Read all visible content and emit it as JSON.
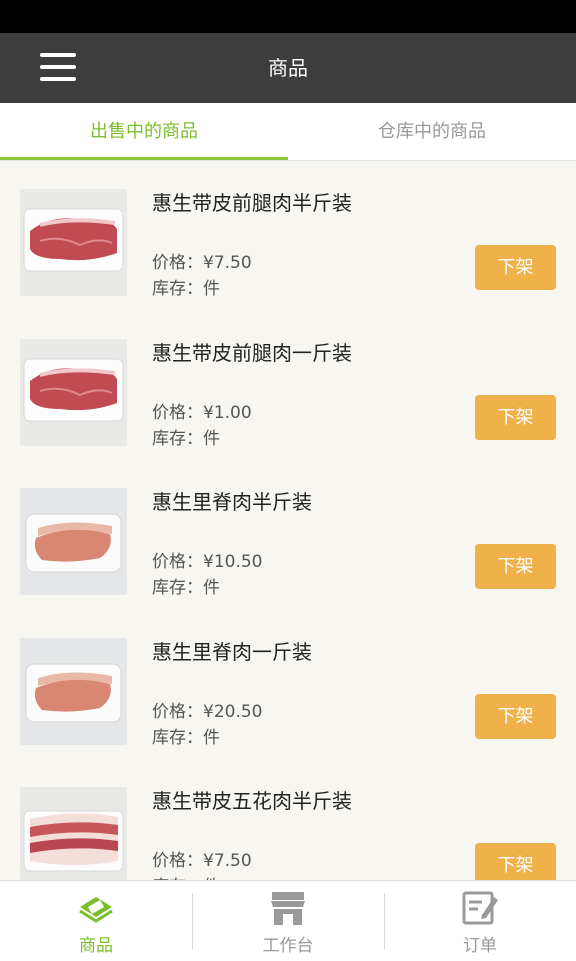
{
  "header": {
    "title": "商品"
  },
  "tabs": [
    {
      "label": "出售中的商品"
    },
    {
      "label": "仓库中的商品"
    }
  ],
  "products": [
    {
      "name": "惠生带皮前腿肉半斤装",
      "price": "价格：¥7.50",
      "stock": "库存：件",
      "action": "下架",
      "image": "meat-slices-on-tray"
    },
    {
      "name": "惠生带皮前腿肉一斤装",
      "price": "价格：¥1.00",
      "stock": "库存：件",
      "action": "下架",
      "image": "meat-slices-on-tray"
    },
    {
      "name": "惠生里脊肉半斤装",
      "price": "价格：¥10.50",
      "stock": "库存：件",
      "action": "下架",
      "image": "tenderloin-on-tray"
    },
    {
      "name": "惠生里脊肉一斤装",
      "price": "价格：¥20.50",
      "stock": "库存：件",
      "action": "下架",
      "image": "tenderloin-on-tray"
    },
    {
      "name": "惠生带皮五花肉半斤装",
      "price": "价格：¥7.50",
      "stock": "库存：件",
      "action": "下架",
      "image": "pork-belly-on-tray"
    }
  ],
  "bottom_nav": [
    {
      "label": "商品",
      "icon": "goods-icon"
    },
    {
      "label": "工作台",
      "icon": "store-icon"
    },
    {
      "label": "订单",
      "icon": "order-edit-icon"
    }
  ],
  "colors": {
    "accent": "#7cbd2b",
    "button": "#f0b04a",
    "appbar": "#3d3d3d"
  }
}
